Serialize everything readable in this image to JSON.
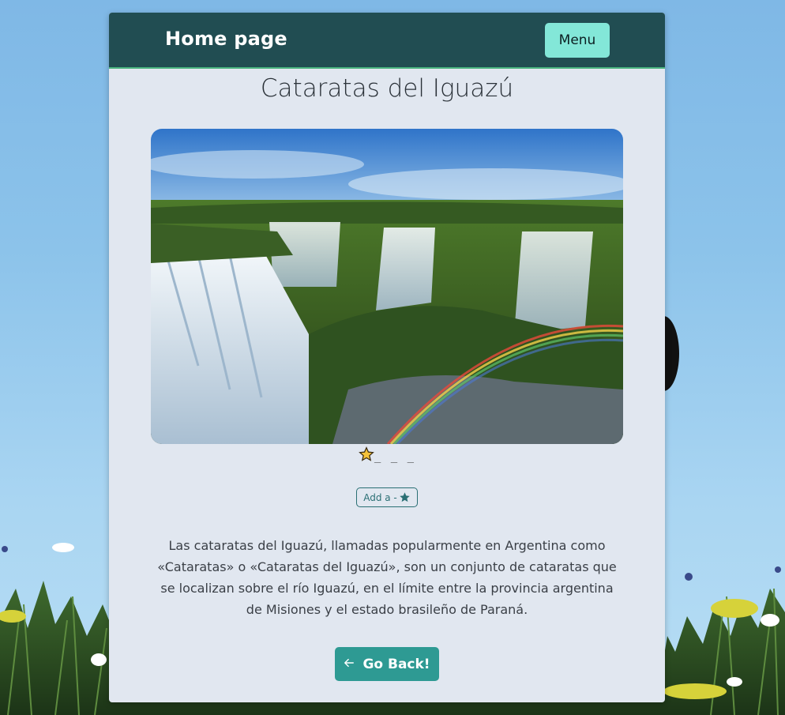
{
  "navbar": {
    "brand": "Home page",
    "menu_label": "Menu"
  },
  "place": {
    "title": "Cataratas del Iguazú",
    "image_subject": "waterfalls-with-rainbow",
    "rating": {
      "stars_filled": 1,
      "empty_slots": "_ _ _"
    },
    "add_button_label": "Add a -",
    "description": "Las cataratas del Iguazú, llamadas popularmente en Argentina como «Cataratas» o «Cataratas del Iguazú», son un conjunto de cataratas que se localizan sobre el río Iguazú, en el límite entre la provincia argentina de Misiones y el estado brasileño de Paraná."
  },
  "back_button": {
    "icon": "arrow-left-icon",
    "label": "Go Back!"
  },
  "colors": {
    "navbar_bg": "#214d52",
    "menu_button": "#83e7d8",
    "card_bg": "#e1e7f0",
    "accent_teal": "#2e9a93",
    "star_fill": "#f5c33b"
  }
}
